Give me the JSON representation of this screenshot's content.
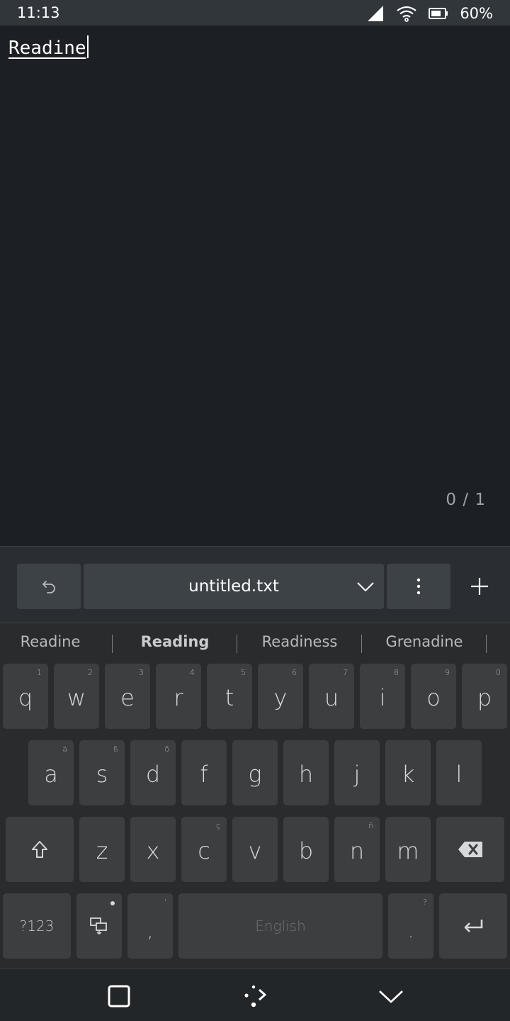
{
  "status_bar": {
    "time": "11:13",
    "battery_percent": "60%",
    "icons": [
      "signal-icon",
      "wifi-icon",
      "battery-icon"
    ]
  },
  "editor": {
    "text": "Readine",
    "page_counter": "0 / 1"
  },
  "toolbar": {
    "undo_icon": "undo-icon",
    "file_name": "untitled.txt",
    "file_menu_icon": "chevron-down-icon",
    "more_icon": "more-vertical-icon",
    "add_icon": "plus-icon"
  },
  "keyboard": {
    "suggestions": [
      {
        "text": "Readine",
        "bold": false
      },
      {
        "text": "Reading",
        "bold": true
      },
      {
        "text": "Readiness",
        "bold": false
      },
      {
        "text": "Grenadine",
        "bold": false
      }
    ],
    "row1": [
      {
        "key": "q",
        "hint": "1"
      },
      {
        "key": "w",
        "hint": "2"
      },
      {
        "key": "e",
        "hint": "3"
      },
      {
        "key": "r",
        "hint": "4"
      },
      {
        "key": "t",
        "hint": "5"
      },
      {
        "key": "y",
        "hint": "6"
      },
      {
        "key": "u",
        "hint": "7"
      },
      {
        "key": "i",
        "hint": "8"
      },
      {
        "key": "o",
        "hint": "9"
      },
      {
        "key": "p",
        "hint": "0"
      }
    ],
    "row2": [
      {
        "key": "a",
        "hint": "ä"
      },
      {
        "key": "s",
        "hint": "ß"
      },
      {
        "key": "d",
        "hint": "ð"
      },
      {
        "key": "f",
        "hint": ""
      },
      {
        "key": "g",
        "hint": ""
      },
      {
        "key": "h",
        "hint": ""
      },
      {
        "key": "j",
        "hint": ""
      },
      {
        "key": "k",
        "hint": ""
      },
      {
        "key": "l",
        "hint": ""
      }
    ],
    "row3": [
      {
        "key": "z",
        "hint": ""
      },
      {
        "key": "x",
        "hint": ""
      },
      {
        "key": "c",
        "hint": "ç"
      },
      {
        "key": "v",
        "hint": ""
      },
      {
        "key": "b",
        "hint": ""
      },
      {
        "key": "n",
        "hint": "ñ"
      },
      {
        "key": "m",
        "hint": ""
      }
    ],
    "symbols_label": "?123",
    "comma": {
      "key": ",",
      "hint": "'"
    },
    "space_label": "English",
    "period": {
      "key": ".",
      "hint": "?"
    }
  },
  "nav_bar": {
    "icons": [
      "square-icon",
      "drag-icon",
      "chevron-down-icon"
    ]
  },
  "colors": {
    "background": "#1c1f23",
    "status_bar": "#31363b",
    "key": "#3d3e40",
    "keyboard_bg": "#2a2b2d"
  }
}
